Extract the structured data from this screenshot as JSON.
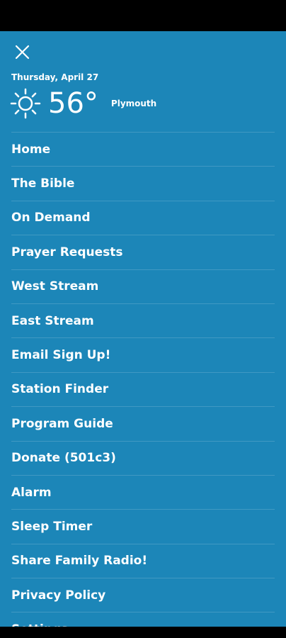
{
  "header": {
    "close_icon": "close-icon",
    "date": "Thursday, April 27",
    "weather": {
      "icon": "sun-icon",
      "temperature": "56°",
      "location": "Plymouth"
    }
  },
  "menu": {
    "items": [
      {
        "label": "Home"
      },
      {
        "label": "The Bible"
      },
      {
        "label": "On Demand"
      },
      {
        "label": "Prayer Requests"
      },
      {
        "label": "West Stream"
      },
      {
        "label": "East Stream"
      },
      {
        "label": "Email Sign Up!"
      },
      {
        "label": "Station Finder"
      },
      {
        "label": "Program Guide"
      },
      {
        "label": "Donate (501c3)"
      },
      {
        "label": "Alarm"
      },
      {
        "label": "Sleep Timer"
      },
      {
        "label": "Share Family Radio!"
      },
      {
        "label": "Privacy Policy"
      },
      {
        "label": "Settings"
      }
    ]
  },
  "colors": {
    "drawer_background": "#1c86b8",
    "text": "#ffffff",
    "system_bars": "#000000"
  }
}
